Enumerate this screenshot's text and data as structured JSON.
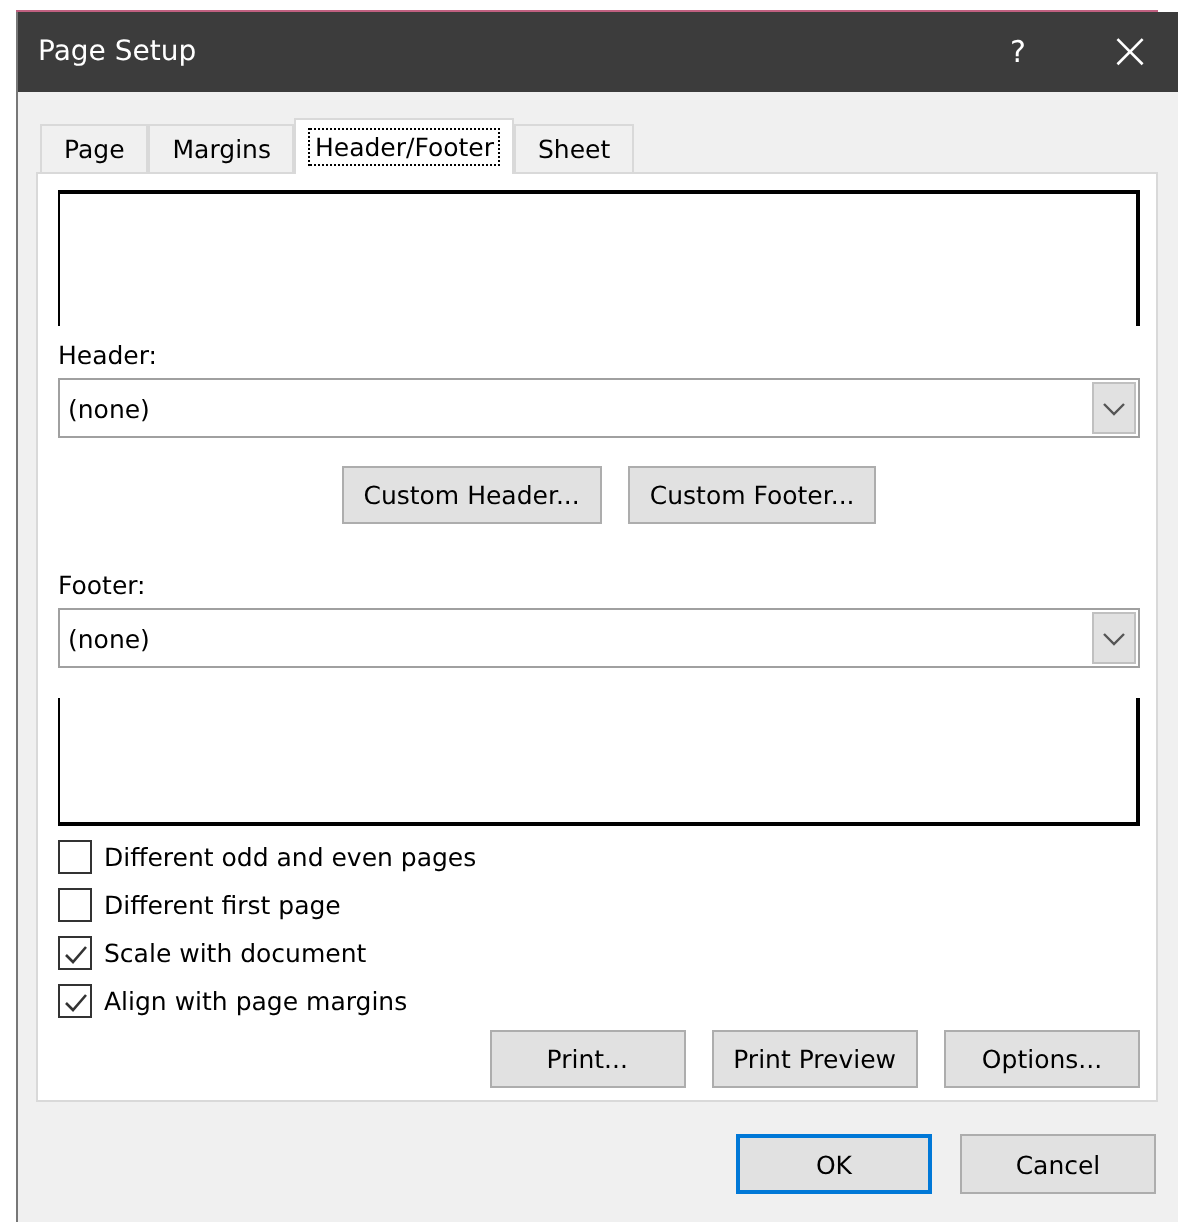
{
  "window": {
    "title": "Page Setup",
    "help": "?",
    "close": "×"
  },
  "tabs": [
    {
      "label": "Page",
      "selected": false
    },
    {
      "label": "Margins",
      "selected": false
    },
    {
      "label": "Header/Footer",
      "selected": true
    },
    {
      "label": "Sheet",
      "selected": false
    }
  ],
  "header": {
    "label": "Header:",
    "value": "(none)"
  },
  "custom_buttons": [
    "Custom Header...",
    "Custom Footer..."
  ],
  "footer": {
    "label": "Footer:",
    "value": "(none)"
  },
  "options": [
    {
      "label": "Different odd and even pages",
      "checked": false
    },
    {
      "label": "Different first page",
      "checked": false
    },
    {
      "label": "Scale with document",
      "checked": true
    },
    {
      "label": "Align with page margins",
      "checked": true
    }
  ],
  "panel_buttons": [
    "Print...",
    "Print Preview",
    "Options..."
  ],
  "dialog_buttons": [
    {
      "label": "OK",
      "default": true
    },
    {
      "label": "Cancel",
      "default": false
    }
  ]
}
